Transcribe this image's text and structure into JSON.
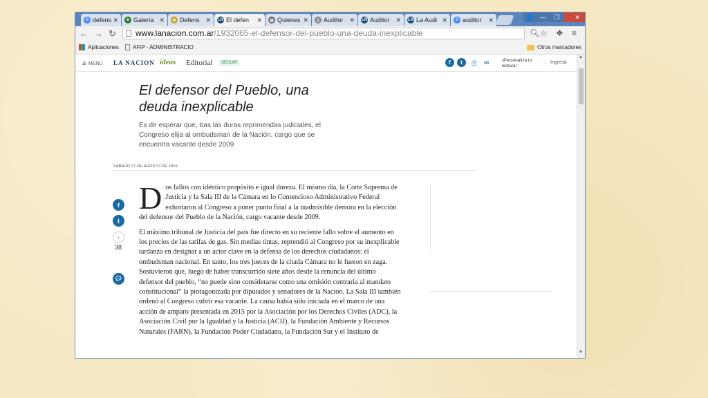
{
  "browser": {
    "tabs": [
      {
        "label": "defens",
        "icon": "google-icon",
        "color": "#4285f4",
        "glyph": "G"
      },
      {
        "label": "Galería",
        "icon": "tree-icon",
        "color": "#2e7d32",
        "glyph": "♣"
      },
      {
        "label": "Defens",
        "icon": "shield-icon",
        "color": "#c9a227",
        "glyph": "✿"
      },
      {
        "label": "El defen",
        "icon": "lanacion-icon",
        "color": "#1a4b7a",
        "glyph": "LN",
        "active": true
      },
      {
        "label": "Quienes",
        "icon": "bars-icon",
        "color": "#6a6a6a",
        "glyph": "▥"
      },
      {
        "label": "Auditor",
        "icon": "page-icon",
        "color": "#888888",
        "glyph": "▯"
      },
      {
        "label": "Auditor",
        "icon": "lanacion-icon",
        "color": "#1a4b7a",
        "glyph": "LN"
      },
      {
        "label": "La Audi",
        "icon": "lanacion-icon",
        "color": "#1a4b7a",
        "glyph": "LN"
      },
      {
        "label": "auditor",
        "icon": "google-icon",
        "color": "#4285f4",
        "glyph": "G"
      }
    ],
    "url_host": "www.lanacion.com.ar",
    "url_path": "/1932065-el-defensor-del-pueblo-una-deuda-inexplicable",
    "bookmarks": {
      "apps": "Aplicaciones",
      "afip": "AFIP - ADMINISTRACIO",
      "others": "Otros marcadores"
    }
  },
  "site": {
    "menu": "MENÚ",
    "logo": "LA NACION",
    "ideas": "ideas",
    "section": "Editorial",
    "follow": "SEGUIR",
    "personalize": "¡Personalizá tu lectura!",
    "login": "Ingresá"
  },
  "article": {
    "title": "El defensor del Pueblo, una deuda inexplicable",
    "subtitle": "Es de esperar que, tras las duras reprimendas judiciales, el Congreso elija al ombudsman de la Nación, cargo que se encuentra vacante desde 2009",
    "date": "SÁBADO 27 DE AGOSTO DE 2016",
    "comment_count": "38",
    "dropcap": "D",
    "para1": "os fallos con idéntico propósito e igual dureza. El mismo día, la Corte Suprema de Justicia y la Sala III de la Cámara en lo Contencioso Administrativo Federal exhortaron al Congreso a poner punto final a la inadmisible demora en la elección del defensor del Pueblo de la Nación, cargo vacante desde 2009.",
    "para2": "El máximo tribunal de Justicia del país fue directo en su reciente fallo sobre el aumento en los precios de las tarifas de gas. Sin medias tintas, reprendió al Congreso por su inexplicable tardanza en designar a un actor clave en la defensa de los derechos ciudadanos: el ombudsman nacional. En tanto, los tres jueces de la citada Cámara no le fueron en zaga. Sostuvieron que, luego de haber transcurrido siete años desde la renuncia del último defensor del pueblo, “no puede sino considerarse como una omisión contraria al mandato constitucional” la protagonizada por diputados y senadores de la Nación. La Sala III también ordenó al Congreso cubrir esa vacante. La causa había sido iniciada en el marco de una acción de amparo presentada en 2015 por la Asociación por los Derechos Civiles (ADC), la Asociación Civil por la Igualdad y la Justicia (ACIJ), la Fundación Ambiente y Recursos Naturales (FARN), la Fundación Poder Ciudadano, la Fundación Sur y el Instituto de"
  }
}
